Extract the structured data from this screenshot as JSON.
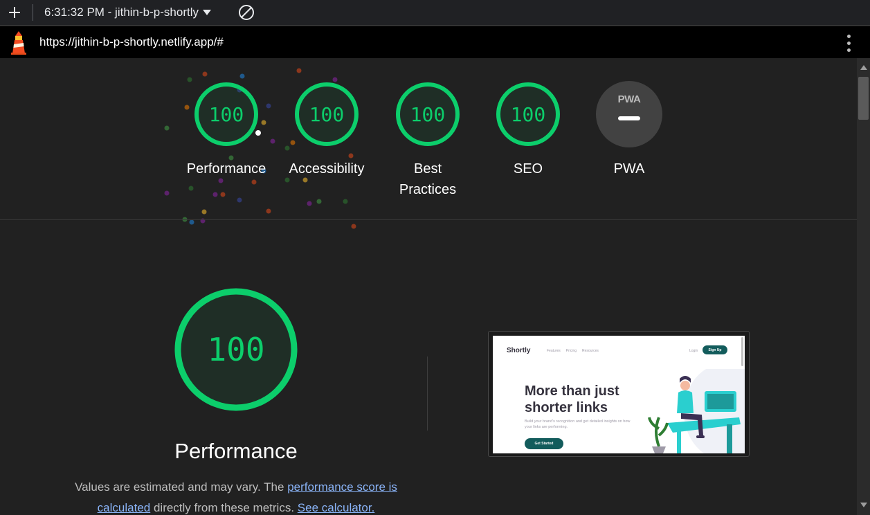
{
  "toolbar": {
    "session_label": "6:31:32 PM - jithin-b-p-shortly"
  },
  "urlbar": {
    "url": "https://jithin-b-p-shortly.netlify.app/#"
  },
  "colors": {
    "pass": "#0cce6b",
    "background": "#212121",
    "link": "#8ab4f8"
  },
  "scores": [
    {
      "label": "Performance",
      "score": "100"
    },
    {
      "label": "Accessibility",
      "score": "100"
    },
    {
      "label": "Best Practices",
      "score": "100"
    },
    {
      "label": "SEO",
      "score": "100"
    }
  ],
  "pwa": {
    "label": "PWA",
    "badge_text": "PWA"
  },
  "performance": {
    "score": "100",
    "title": "Performance",
    "note_prefix": "Values are estimated and may vary. The ",
    "note_link1": "performance score is calculated",
    "note_middle": " directly from these metrics. ",
    "note_link2": "See calculator."
  },
  "thumbnail": {
    "logo": "Shortly",
    "nav": [
      "Features",
      "Pricing",
      "Resources"
    ],
    "login": "Login",
    "signup": "Sign Up",
    "hero": "More than just shorter links",
    "sub": "Build your brand's recognition and get detailed insights on how your links are performing.",
    "cta": "Get Started"
  }
}
